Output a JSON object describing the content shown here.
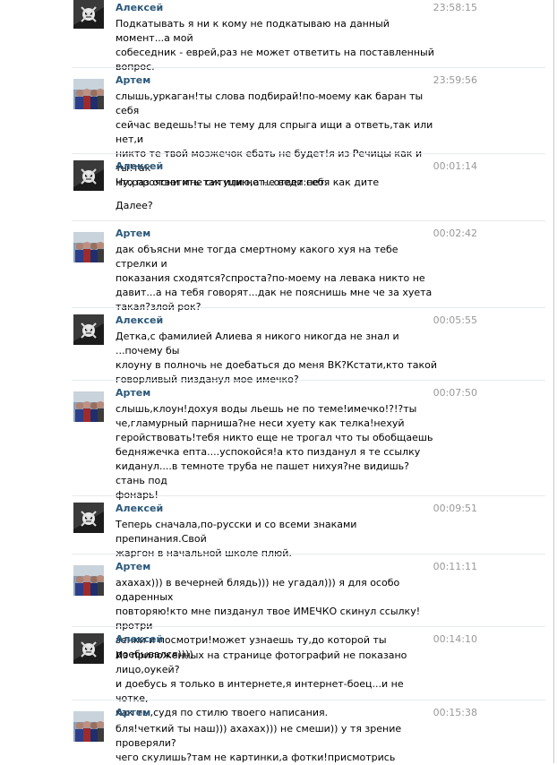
{
  "messages": [
    {
      "author": "Алексей",
      "avatar": "pirate-avatar",
      "time": "23:58:15",
      "text": "Подкатывать я ни к кому не подкатываю на данный момент...а мой\nсобеседник - еврей,раз не может ответить на поставленный\nвопрос."
    },
    {
      "author": "Артем",
      "avatar": "group-photo-avatar",
      "time": "23:59:56",
      "text": "слышь,уркаган!ты слова подбирай!по-моему как баран ты себя\nсейчас ведешь!ты не тему для спрыга ищи а ответь,так или нет,и\nникто те твой мозжечок ебать не будет!я из Речицы как и ты!так\nчто проясни мне ситуцию,а не веди себя как дите"
    },
    {
      "author": "Алексей",
      "avatar": "pirate-avatar",
      "time": "00:01:14",
      "text": "Ну,раз ответить так или нет...ответ:нет.",
      "text2": "Далее?"
    },
    {
      "author": "Артем",
      "avatar": "group-photo-avatar",
      "time": "00:02:42",
      "text": "дак объясни мне тогда смертному какого хуя на тебе стрелки и\nпоказания сходятся?спроста?по-моему на левака никто не\nдавит...а на тебя говорят...дак не пояснишь мне че за хуета\nтакая?злой рок?"
    },
    {
      "author": "Алексей",
      "avatar": "pirate-avatar",
      "time": "00:05:55",
      "text": "Детка,с фамилией Алиева я никого никогда не знал и ...почему бы\nклоуну в полночь не доебаться до меня ВК?Кстати,кто такой\nговорливый пизданул мое имечко?"
    },
    {
      "author": "Артем",
      "avatar": "group-photo-avatar",
      "time": "00:07:50",
      "text": "слышь,клоун!дохуя воды льешь не по теме!имечко!?!?ты\nче,гламурный парниша?не неси хуету как телка!нехуй\nгеройствовать!тебя никто еще не трогал что ты обобщаешь\nбедняжечка епта....успокойся!а кто пизданул я те ссылку\nкиданул....в темноте труба не пашет нихуя?не видишь?стань под\nфонарь!"
    },
    {
      "author": "Алексей",
      "avatar": "pirate-avatar",
      "time": "00:09:51",
      "text": "Теперь сначала,по-русски и со всеми знаками препинания.Свой\nжаргон в начальной школе плюй."
    },
    {
      "author": "Артем",
      "avatar": "group-photo-avatar",
      "time": "00:11:11",
      "text": "ахахах))) в вечерней блядь))) не угадал))) я для особо одаренных\nповторяю!кто мне пизданул твое ИМЕЧКО скинул ссылку!протри\nзенки и посмотри!может узнаешь ту,до которой ты доебывался))))"
    },
    {
      "author": "Алексей",
      "avatar": "pirate-avatar",
      "time": "00:14:10",
      "text": "Из приложенных на странице фотографий не показано лицо,оукей?\nи доебусь я только в интернете,я интернет-боец...и не чотке,\nкак ты,судя по стилю твоего написания."
    },
    {
      "author": "Артем",
      "avatar": "group-photo-avatar",
      "time": "00:15:38",
      "text": "бля!четкий ты наш))) ахахах))) не смеши)) у тя зрение проверяли?\nчего скулишь?там не картинки,а фотки!присмотрись"
    }
  ]
}
